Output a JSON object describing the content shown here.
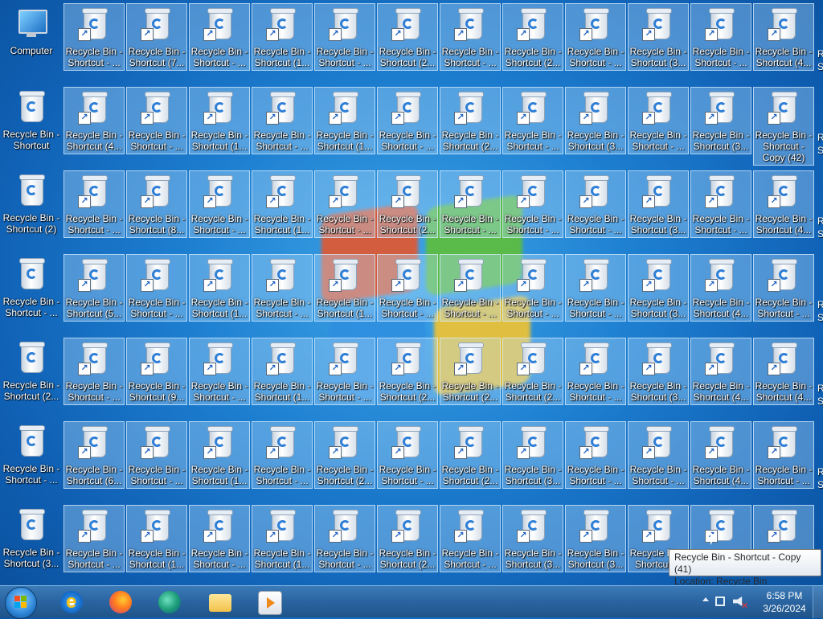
{
  "desktop": {
    "computer_label": "Computer",
    "rows": [
      [
        "Recycle Bin - Shortcut - ...",
        "Recycle Bin - Shortcut (7...",
        "Recycle Bin - Shortcut - ...",
        "Recycle Bin - Shortcut (1...",
        "Recycle Bin - Shortcut - ...",
        "Recycle Bin - Shortcut (2...",
        "Recycle Bin - Shortcut - ...",
        "Recycle Bin - Shortcut (2...",
        "Recycle Bin - Shortcut - ...",
        "Recycle Bin - Shortcut (3...",
        "Recycle Bin - Shortcut - ...",
        "Recycle Bin - Shortcut (4..."
      ],
      [
        "Recycle Bin - Shortcut",
        "Recycle Bin - Shortcut (4...",
        "Recycle Bin - Shortcut - ...",
        "Recycle Bin - Shortcut (1...",
        "Recycle Bin - Shortcut - ...",
        "Recycle Bin - Shortcut (1...",
        "Recycle Bin - Shortcut - ...",
        "Recycle Bin - Shortcut (2...",
        "Recycle Bin - Shortcut - ...",
        "Recycle Bin - Shortcut (3...",
        "Recycle Bin - Shortcut - ...",
        "Recycle Bin - Shortcut (3...",
        "Recycle Bin - Shortcut - Copy (42)"
      ],
      [
        "Recycle Bin - Shortcut (2)",
        "Recycle Bin - Shortcut - ...",
        "Recycle Bin - Shortcut (8...",
        "Recycle Bin - Shortcut - ...",
        "Recycle Bin - Shortcut (1...",
        "Recycle Bin - Shortcut - ...",
        "Recycle Bin - Shortcut (2...",
        "Recycle Bin - Shortcut - ...",
        "Recycle Bin - Shortcut - ...",
        "Recycle Bin - Shortcut - ...",
        "Recycle Bin - Shortcut (3...",
        "Recycle Bin - Shortcut - ...",
        "Recycle Bin - Shortcut (4..."
      ],
      [
        "Recycle Bin - Shortcut - ...",
        "Recycle Bin - Shortcut (5...",
        "Recycle Bin - Shortcut - ...",
        "Recycle Bin - Shortcut (1...",
        "Recycle Bin - Shortcut - ...",
        "Recycle Bin - Shortcut (1...",
        "Recycle Bin - Shortcut - ...",
        "Recycle Bin - Shortcut - ...",
        "Recycle Bin - Shortcut - ...",
        "Recycle Bin - Shortcut - ...",
        "Recycle Bin - Shortcut (3...",
        "Recycle Bin - Shortcut (4...",
        "Recycle Bin - Shortcut - ..."
      ],
      [
        "Recycle Bin - Shortcut (2...",
        "Recycle Bin - Shortcut - ...",
        "Recycle Bin - Shortcut (9...",
        "Recycle Bin - Shortcut - ...",
        "Recycle Bin - Shortcut (1...",
        "Recycle Bin - Shortcut - ...",
        "Recycle Bin - Shortcut (2...",
        "Recycle Bin - Shortcut (2...",
        "Recycle Bin - Shortcut (2...",
        "Recycle Bin - Shortcut - ...",
        "Recycle Bin - Shortcut (3...",
        "Recycle Bin - Shortcut (4...",
        "Recycle Bin - Shortcut (4..."
      ],
      [
        "Recycle Bin - Shortcut - ...",
        "Recycle Bin - Shortcut (6...",
        "Recycle Bin - Shortcut - ...",
        "Recycle Bin - Shortcut (1...",
        "Recycle Bin - Shortcut - ...",
        "Recycle Bin - Shortcut (2...",
        "Recycle Bin - Shortcut - ...",
        "Recycle Bin - Shortcut (2...",
        "Recycle Bin - Shortcut (3...",
        "Recycle Bin - Shortcut - ...",
        "Recycle Bin - Shortcut - ...",
        "Recycle Bin - Shortcut (4...",
        "Recycle Bin - Shortcut - ..."
      ],
      [
        "Recycle Bin - Shortcut (3...",
        "Recycle Bin - Shortcut - ...",
        "Recycle Bin - Shortcut (1...",
        "Recycle Bin - Shortcut - ...",
        "Recycle Bin - Shortcut (1...",
        "Recycle Bin - Shortcut - ...",
        "Recycle Bin - Shortcut (2...",
        "Recycle Bin - Shortcut - ...",
        "Recycle Bin - Shortcut (3...",
        "Recycle Bin - Shortcut (3...",
        "Recycle Bin - Shortcut ...",
        "",
        ""
      ]
    ],
    "partial_labels": [
      "R",
      "S",
      "R",
      "S",
      "R",
      "S",
      "R",
      "S",
      "R",
      "S",
      "R",
      "S"
    ]
  },
  "tooltip": {
    "line1": "Recycle Bin - Shortcut - Copy (41)",
    "line2": "Location: Recycle Bin"
  },
  "taskbar": {
    "apps": [
      "start-orb",
      "internet-explorer",
      "firefox",
      "edge",
      "file-explorer",
      "media-player"
    ],
    "clock_time": "6:58 PM",
    "clock_date": "3/26/2024"
  }
}
